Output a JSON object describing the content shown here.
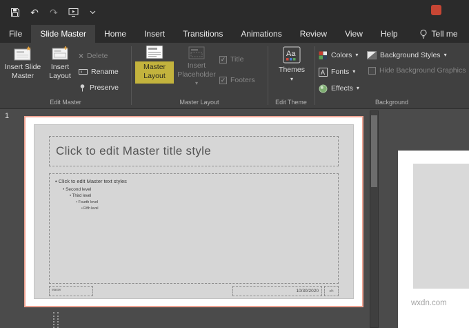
{
  "icons": {
    "undo": "↶",
    "redo": "↷",
    "delete_x": "×",
    "check": "✓",
    "caret": "▾"
  },
  "tabs": {
    "items": [
      {
        "label": "File"
      },
      {
        "label": "Slide Master",
        "active": true
      },
      {
        "label": "Home"
      },
      {
        "label": "Insert"
      },
      {
        "label": "Transitions"
      },
      {
        "label": "Animations"
      },
      {
        "label": "Review"
      },
      {
        "label": "View"
      },
      {
        "label": "Help"
      }
    ],
    "tell_me_label": "Tell me"
  },
  "ribbon": {
    "edit_master": {
      "group_label": "Edit Master",
      "insert_slide_master_label": "Insert Slide Master",
      "insert_layout_label": "Insert Layout",
      "delete_label": "Delete",
      "rename_label": "Rename",
      "preserve_label": "Preserve"
    },
    "master_layout": {
      "group_label": "Master Layout",
      "master_layout_label": "Master Layout",
      "insert_placeholder_label": "Insert Placeholder",
      "title_label": "Title",
      "footers_label": "Footers"
    },
    "edit_theme": {
      "group_label": "Edit Theme",
      "themes_label": "Themes"
    },
    "background": {
      "group_label": "Background",
      "colors_label": "Colors",
      "fonts_label": "Fonts",
      "effects_label": "Effects",
      "background_styles_label": "Background Styles",
      "hide_background_graphics_label": "Hide Background Graphics"
    }
  },
  "slides_panel": {
    "slide_number": "1"
  },
  "slide": {
    "title_placeholder": "Click to edit Master title style",
    "body_levels": [
      "Click to edit Master text styles",
      "Second level",
      "Third level",
      "Fourth level",
      "Fifth level"
    ],
    "footer_text": "Master",
    "date_text": "10/30/2020",
    "number_text": "‹#›"
  },
  "watermark": "wxdn.com",
  "colors": {
    "highlight_yellow": "#c3b33d",
    "selection_border": "#efa493",
    "titlebar_bg": "#2b2b2b",
    "ribbon_bg": "#404040",
    "app_red": "#c74634"
  }
}
